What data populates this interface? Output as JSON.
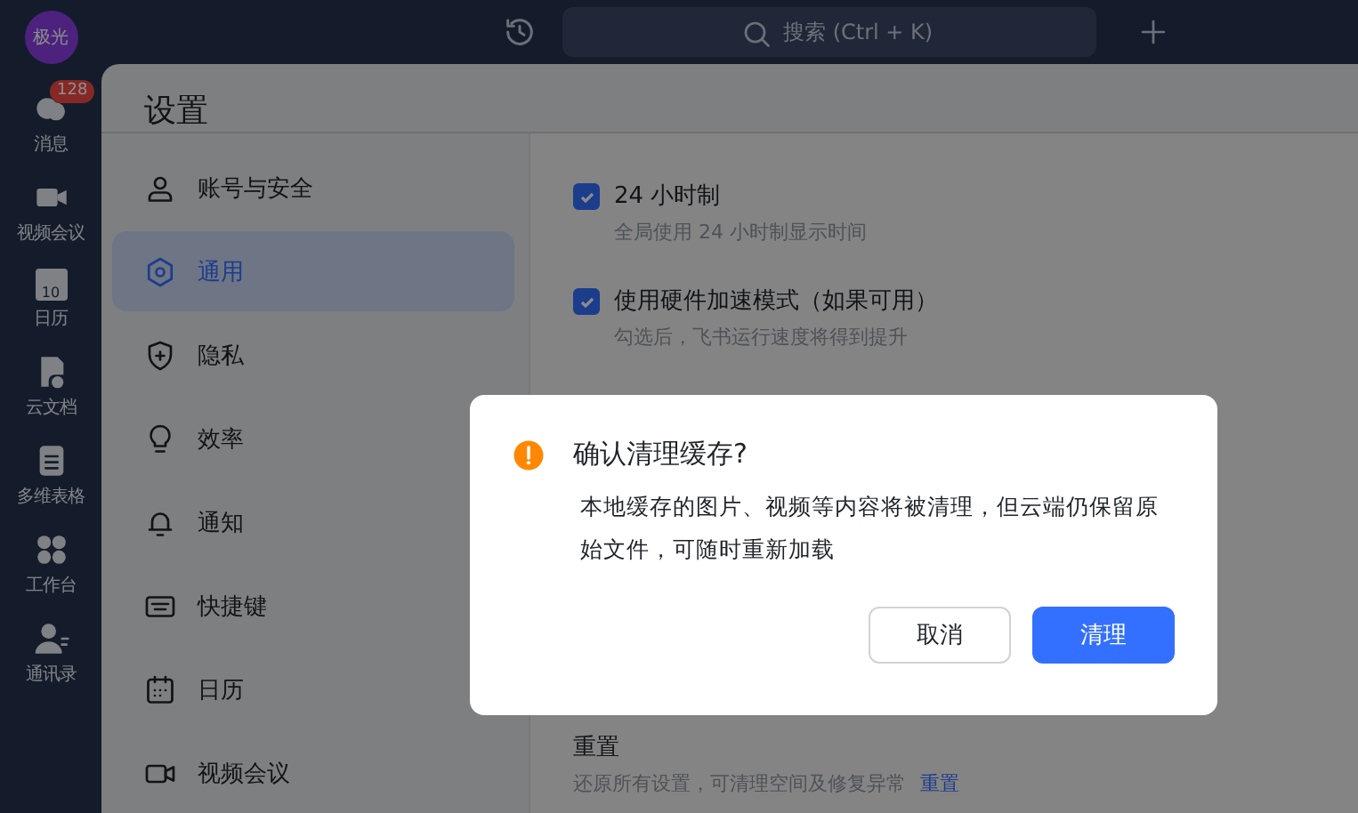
{
  "rail": {
    "avatar": "极光",
    "items": [
      {
        "label": "消息",
        "badge": "128",
        "selected": false
      },
      {
        "label": "视频会议",
        "selected": false
      },
      {
        "label": "日历",
        "day": "10",
        "selected": false
      },
      {
        "label": "云文档",
        "selected": false
      },
      {
        "label": "多维表格",
        "selected": false
      },
      {
        "label": "工作台",
        "selected": false
      },
      {
        "label": "通讯录",
        "selected": false
      }
    ]
  },
  "topbar": {
    "search": {
      "placeholder": "搜索 (Ctrl + K)"
    }
  },
  "settings": {
    "title": "设置",
    "nav": [
      {
        "label": "账号与安全",
        "selected": false
      },
      {
        "label": "通用",
        "selected": true
      },
      {
        "label": "隐私",
        "selected": false
      },
      {
        "label": "效率",
        "selected": false
      },
      {
        "label": "通知",
        "selected": false
      },
      {
        "label": "快捷键",
        "selected": false
      },
      {
        "label": "日历",
        "selected": false
      },
      {
        "label": "视频会议",
        "selected": false
      }
    ],
    "options": [
      {
        "label": "24 小时制",
        "description": "全局使用 24 小时制显示时间",
        "checked": true
      },
      {
        "label": "使用硬件加速模式（如果可用）",
        "description": "勾选后，飞书运行速度将得到提升",
        "checked": true
      }
    ],
    "reset": {
      "title": "重置",
      "description": "还原所有设置，可清理空间及修复异常",
      "link": "重置"
    }
  },
  "dialog": {
    "title": "确认清理缓存?",
    "message": "本地缓存的图片、视频等内容将被清理，但云端仍保留原始文件，可随时重新加载",
    "buttons": [
      {
        "label": "取消",
        "kind": "secondary"
      },
      {
        "label": "清理",
        "kind": "primary"
      }
    ]
  }
}
